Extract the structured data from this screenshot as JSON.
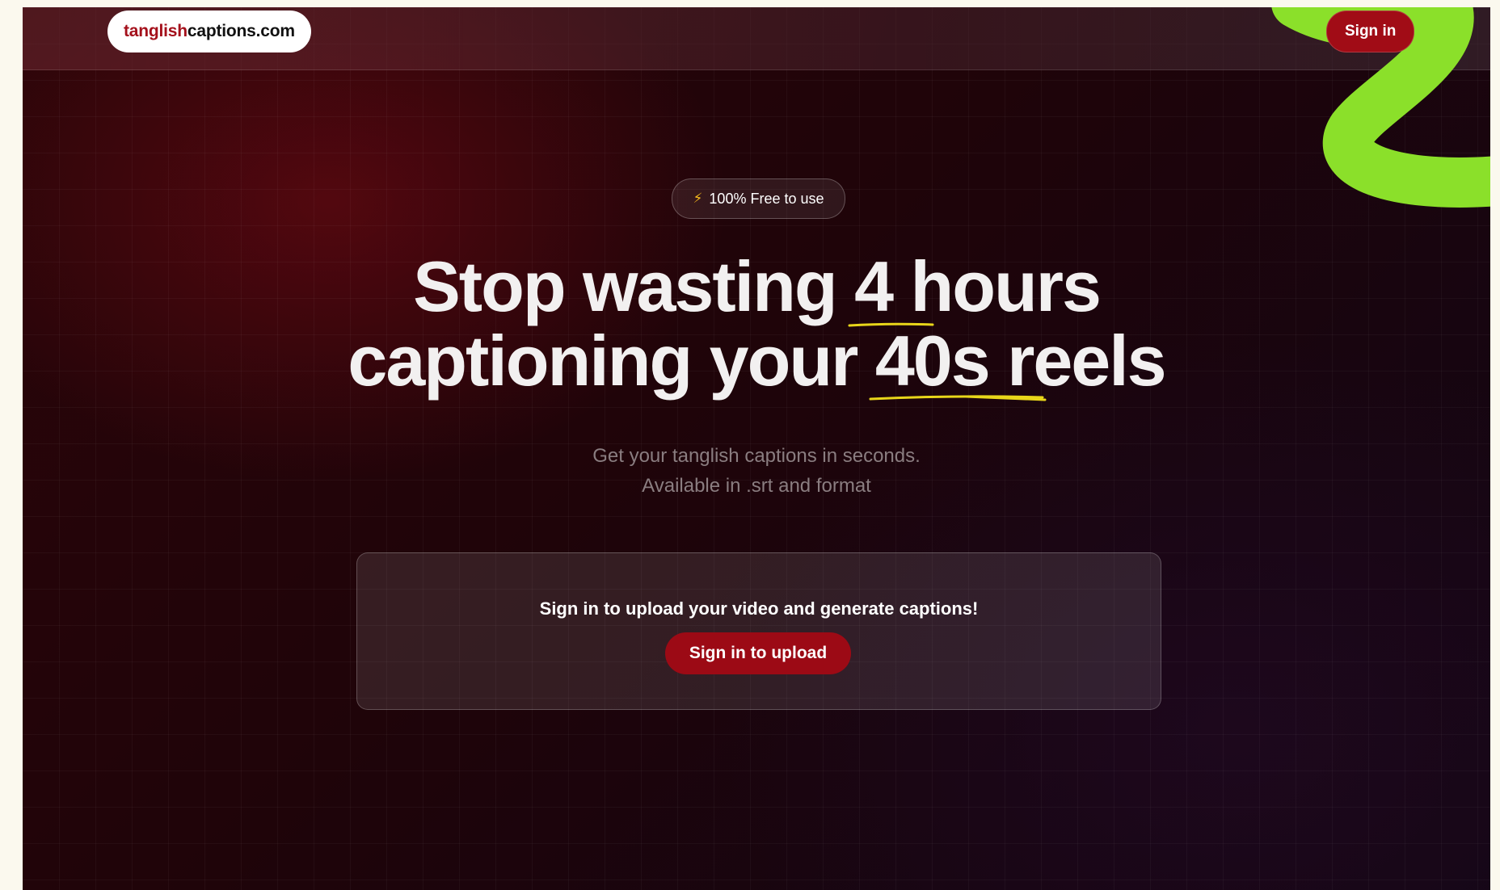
{
  "navbar": {
    "logo_part1": "tanglish",
    "logo_part2": "captions.com",
    "signin_label": "Sign in"
  },
  "hero": {
    "badge_icon": "lightning-bolt-icon",
    "badge_glyph": "⚡",
    "badge_text": "100% Free to use",
    "headline_line1_before": "Stop wasting ",
    "headline_line1_highlight": "4 hours",
    "headline_line2_before": "captioning your ",
    "headline_line2_highlight": "40s",
    "headline_line2_after": " reels",
    "subhead_line1": "Get your tanglish captions in seconds.",
    "subhead_line2": "Available in .srt and format"
  },
  "upload_card": {
    "message": "Sign in to upload your video and generate captions!",
    "button_label": "Sign in to upload"
  },
  "colors": {
    "brand_red": "#a10c16",
    "accent_green": "#8be02a",
    "underline_yellow": "#e8d61a",
    "page_background": "#fbf9ee"
  }
}
